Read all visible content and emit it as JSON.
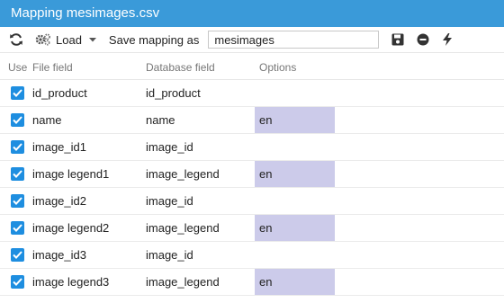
{
  "title": "Mapping mesimages.csv",
  "toolbar": {
    "refresh_icon": "refresh-icon",
    "load_icon": "cog-icon",
    "load_label": "Load",
    "save_label": "Save mapping as",
    "mapping_name": "mesimages",
    "save_icon": "floppy-icon",
    "delete_icon": "minus-circle-icon",
    "run_icon": "bolt-icon"
  },
  "columns": {
    "use": "Use",
    "file": "File field",
    "db": "Database field",
    "options": "Options"
  },
  "rows": [
    {
      "checked": true,
      "file": "id_product",
      "db": "id_product",
      "option": ""
    },
    {
      "checked": true,
      "file": "name",
      "db": "name",
      "option": "en"
    },
    {
      "checked": true,
      "file": "image_id1",
      "db": "image_id",
      "option": ""
    },
    {
      "checked": true,
      "file": "image legend1",
      "db": "image_legend",
      "option": "en"
    },
    {
      "checked": true,
      "file": "image_id2",
      "db": "image_id",
      "option": ""
    },
    {
      "checked": true,
      "file": "image legend2",
      "db": "image_legend",
      "option": "en"
    },
    {
      "checked": true,
      "file": "image_id3",
      "db": "image_id",
      "option": ""
    },
    {
      "checked": true,
      "file": "image legend3",
      "db": "image_legend",
      "option": "en"
    }
  ],
  "colors": {
    "titlebar": "#3a9ad9",
    "checkbox": "#1e8ee0",
    "option_cell": "#cccbea"
  }
}
